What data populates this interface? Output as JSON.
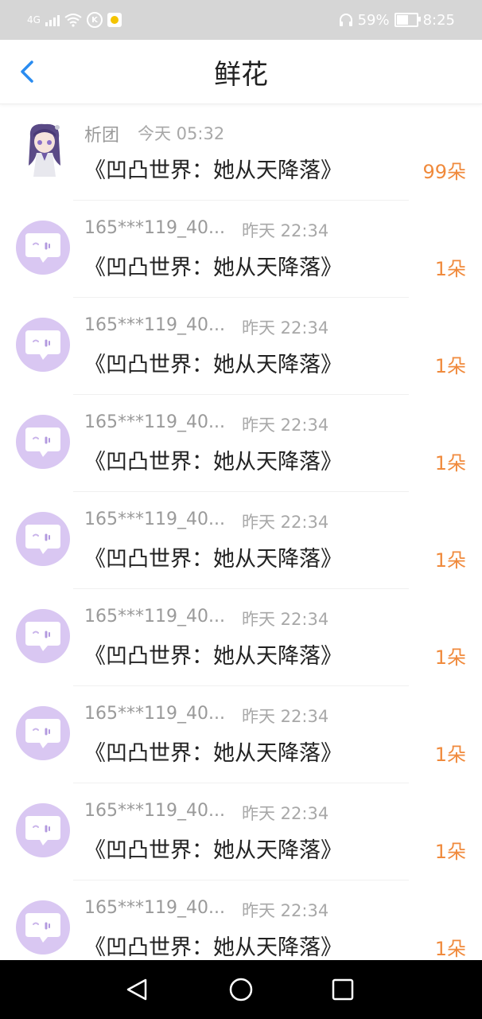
{
  "status_bar": {
    "network": "4G",
    "battery": "59%",
    "time": "8:25",
    "icons": [
      "signal-icon",
      "wifi-icon",
      "k-icon",
      "app-notification-icon",
      "headphone-icon",
      "battery-icon"
    ]
  },
  "header": {
    "title": "鲜花",
    "back_icon": "back-arrow-icon"
  },
  "flowers": [
    {
      "name": "析团",
      "time": "今天 05:32",
      "book": "《凹凸世界：她从天降落》",
      "count": "99朵",
      "avatar": "anime-avatar"
    },
    {
      "name": "165***119_40...",
      "time": "昨天 22:34",
      "book": "《凹凸世界：她从天降落》",
      "count": "1朵",
      "avatar": "default-avatar"
    },
    {
      "name": "165***119_40...",
      "time": "昨天 22:34",
      "book": "《凹凸世界：她从天降落》",
      "count": "1朵",
      "avatar": "default-avatar"
    },
    {
      "name": "165***119_40...",
      "time": "昨天 22:34",
      "book": "《凹凸世界：她从天降落》",
      "count": "1朵",
      "avatar": "default-avatar"
    },
    {
      "name": "165***119_40...",
      "time": "昨天 22:34",
      "book": "《凹凸世界：她从天降落》",
      "count": "1朵",
      "avatar": "default-avatar"
    },
    {
      "name": "165***119_40...",
      "time": "昨天 22:34",
      "book": "《凹凸世界：她从天降落》",
      "count": "1朵",
      "avatar": "default-avatar"
    },
    {
      "name": "165***119_40...",
      "time": "昨天 22:34",
      "book": "《凹凸世界：她从天降落》",
      "count": "1朵",
      "avatar": "default-avatar"
    },
    {
      "name": "165***119_40...",
      "time": "昨天 22:34",
      "book": "《凹凸世界：她从天降落》",
      "count": "1朵",
      "avatar": "default-avatar"
    },
    {
      "name": "165***119_40...",
      "time": "昨天 22:34",
      "book": "《凹凸世界：她从天降落》",
      "count": "1朵",
      "avatar": "default-avatar"
    }
  ],
  "colors": {
    "accent_count": "#f08a3c",
    "avatar_bg": "#d9c7f2",
    "back_arrow": "#2a8cf0",
    "status_bar_bg": "#d6d6d6"
  },
  "nav": {
    "icons": [
      "back-triangle-icon",
      "home-circle-icon",
      "recents-square-icon"
    ]
  }
}
